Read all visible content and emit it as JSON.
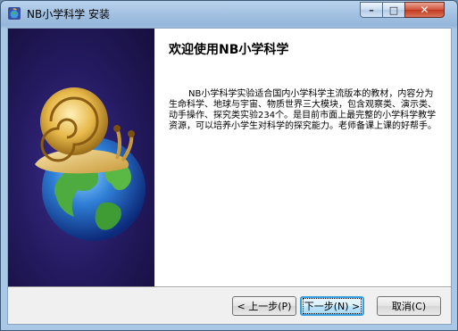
{
  "window": {
    "title": "NB小学科学 安装",
    "controls": {
      "minimize": "–",
      "maximize": "□",
      "close": "✕"
    }
  },
  "icons": [
    "app-icon",
    "snail-icon",
    "globe-icon"
  ],
  "content": {
    "heading": "欢迎使用NB小学科学",
    "description": "NB小学科学实验适合国内小学科学主流版本的教材，内容分为生命科学、地球与宇宙、物质世界三大模块，包含观察类、演示类、动手操作、探究类实验234个。是目前市面上最完整的小学科学教学资源，可以培养小学生对科学的探究能力。老师备课上课的好帮手。"
  },
  "buttons": {
    "back": "< 上一步(P)",
    "next": "下一步(N) >",
    "cancel": "取消(C)"
  },
  "colors": {
    "banner": "#23195e",
    "accent": "#39a0e0"
  }
}
